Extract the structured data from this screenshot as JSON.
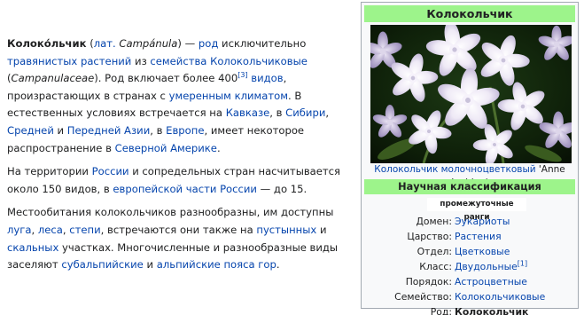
{
  "article": {
    "p1": {
      "name": "Колоко́льчик",
      "open_paren": " (",
      "lat_link": "лат.",
      "lat_space": " ",
      "latin": "Campánula",
      "close_dash": ") — ",
      "rod_link": "род",
      "t1": " исключительно ",
      "grass_link": "травянистых растений",
      "t2": " из ",
      "family_link": "семейства Колокольчиковые",
      "t3": " (",
      "family_latin": "Campanulaceae",
      "t4": "). Род включает более 400",
      "ref3": "[3]",
      "t5": " ",
      "species_link": "видов",
      "t6": ", произрастающих в странах с ",
      "climate_link": "умеренным климатом",
      "t7": ". В естественных условиях встречается на ",
      "caucasus_link": "Кавказе",
      "t8": ", в ",
      "siberia_link": "Сибири",
      "t9": ", ",
      "central_link": "Средней",
      "t10": " и ",
      "near_asia_link": "Передней Азии",
      "t11": ", в ",
      "europe_link": "Европе",
      "t12": ", имеет некоторое распространение в ",
      "na_link": "Северной Америке",
      "t13": "."
    },
    "p2": {
      "t1": "На территории ",
      "russia_link": "России",
      "t2": " и сопредельных стран насчитывается около 150 видов, в ",
      "eu_russia_link": "европейской части России",
      "t3": " — до 15."
    },
    "p3": {
      "t1": "Местообитания колокольчиков разнообразны, им доступны ",
      "meadow_link": "луга",
      "t2": ", ",
      "forest_link": "леса",
      "t3": ", ",
      "steppe_link": "степи",
      "t4": ", встречаются они также на ",
      "desert_link": "пустынных",
      "t5": " и ",
      "rock_link": "скальных",
      "t6": " участках. Многочисленные и разнообразные виды заселяют ",
      "subalp_link": "субальпийские",
      "t7": " и ",
      "alp_link": "альпийские пояса гор",
      "t8": "."
    }
  },
  "infobox": {
    "title": "Колокольчик",
    "caption_link": "Колокольчик молочноцветковый",
    "caption_rest": " 'Anne Loddon'",
    "section": "Научная классификация",
    "ranks": "промежуточные ранги",
    "rows": [
      {
        "label": "Домен:",
        "value": "Эукариоты"
      },
      {
        "label": "Царство:",
        "value": "Растения"
      },
      {
        "label": "Отдел:",
        "value": "Цветковые"
      },
      {
        "label": "Класс:",
        "value": "Двудольные",
        "ref": "[1]"
      },
      {
        "label": "Порядок:",
        "value": "Астроцветные"
      },
      {
        "label": "Семейство:",
        "value": "Колокольчиковые"
      },
      {
        "label": "Род:",
        "value": "Колокольчик"
      }
    ],
    "image": "bellflower-photo"
  },
  "colors": {
    "link": "#0645ad",
    "text": "#202122",
    "header_green": "#9df48b",
    "infobox_bg": "#f8f9fa",
    "infobox_border": "#a2a9b1"
  }
}
